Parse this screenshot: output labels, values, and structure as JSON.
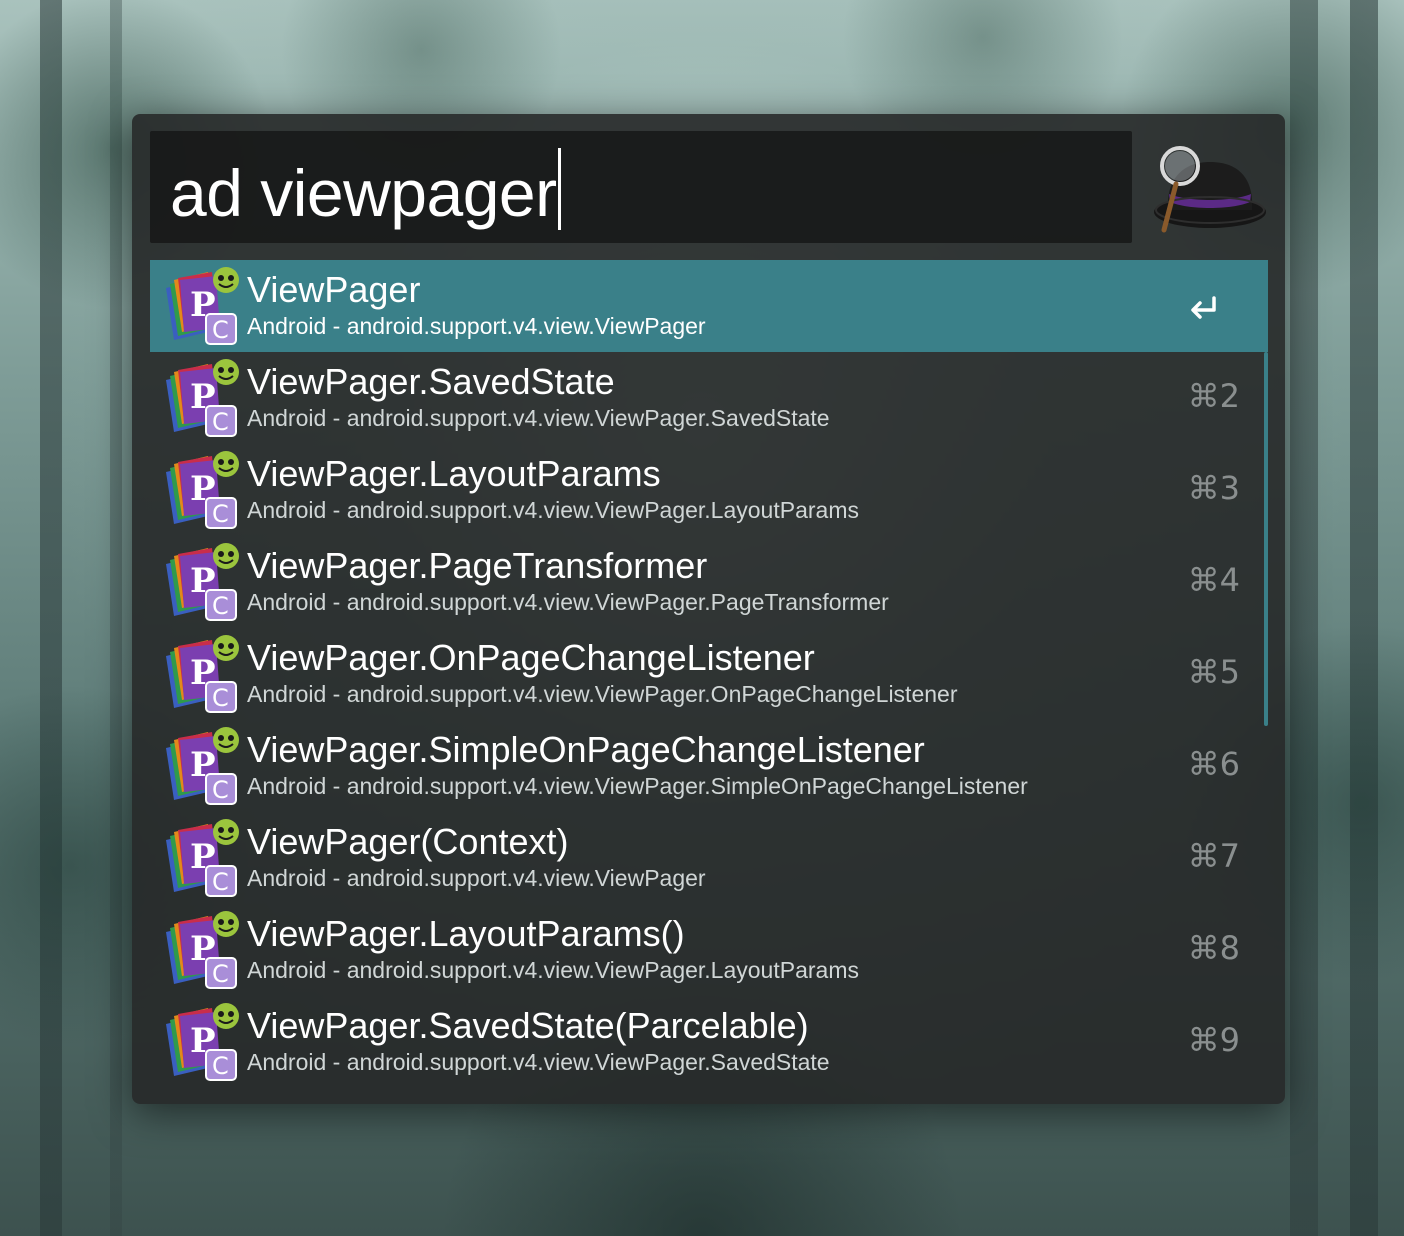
{
  "search": {
    "query": "ad viewpager"
  },
  "results": [
    {
      "title": "ViewPager",
      "subtitle": "Android - android.support.v4.view.ViewPager",
      "shortcut": "↩",
      "selected": true
    },
    {
      "title": "ViewPager.SavedState",
      "subtitle": "Android - android.support.v4.view.ViewPager.SavedState",
      "shortcut": "⌘2"
    },
    {
      "title": "ViewPager.LayoutParams",
      "subtitle": "Android - android.support.v4.view.ViewPager.LayoutParams",
      "shortcut": "⌘3"
    },
    {
      "title": "ViewPager.PageTransformer",
      "subtitle": "Android - android.support.v4.view.ViewPager.PageTransformer",
      "shortcut": "⌘4"
    },
    {
      "title": "ViewPager.OnPageChangeListener",
      "subtitle": "Android - android.support.v4.view.ViewPager.OnPageChangeListener",
      "shortcut": "⌘5"
    },
    {
      "title": "ViewPager.SimpleOnPageChangeListener",
      "subtitle": "Android - android.support.v4.view.ViewPager.SimpleOnPageChangeListener",
      "shortcut": "⌘6"
    },
    {
      "title": "ViewPager(Context)",
      "subtitle": "Android - android.support.v4.view.ViewPager",
      "shortcut": "⌘7"
    },
    {
      "title": "ViewPager.LayoutParams()",
      "subtitle": "Android - android.support.v4.view.ViewPager.LayoutParams",
      "shortcut": "⌘8"
    },
    {
      "title": "ViewPager.SavedState(Parcelable)",
      "subtitle": "Android - android.support.v4.view.ViewPager.SavedState",
      "shortcut": "⌘9"
    }
  ],
  "icons": {
    "app_logo": "alfred-hat-logo-icon",
    "result_icon": "dash-docset-class-icon",
    "return_key": "return-key-icon"
  },
  "colors": {
    "selection": "#3a8089",
    "window_background": "#262828",
    "title_text": "#ffffff",
    "subtitle_text": "#d0d6d6",
    "shortcut_text": "#8a8f8f"
  }
}
